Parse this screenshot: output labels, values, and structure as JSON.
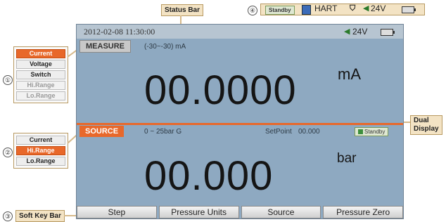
{
  "annotations": {
    "status_bar": "Status Bar",
    "dual_display": "Dual\nDisplay",
    "soft_key_bar": "Soft Key Bar",
    "markers": [
      "①",
      "②",
      "③",
      "④"
    ]
  },
  "status_legend": {
    "standby": "Standby",
    "hart": "HART",
    "voltage": "24V"
  },
  "status_bar": {
    "datetime": "2012-02-08   11:30:00",
    "voltage": "24V"
  },
  "measure": {
    "tab": "MEASURE",
    "range": "(-30~-30) mA",
    "value": "00.0000",
    "unit": "mA"
  },
  "source": {
    "tab": "SOURCE",
    "range": "0 ~ 25bar G",
    "setpoint_label": "SetPoint",
    "setpoint_value": "00.000",
    "standby": "Standby",
    "value": "00.000",
    "unit": "bar"
  },
  "measure_menu": [
    {
      "label": "Current",
      "state": "selected"
    },
    {
      "label": "Voltage",
      "state": "normal"
    },
    {
      "label": "Switch",
      "state": "normal"
    },
    {
      "label": "Hi.Range",
      "state": "disabled"
    },
    {
      "label": "Lo.Range",
      "state": "disabled"
    }
  ],
  "source_menu": [
    {
      "label": "Current",
      "state": "normal"
    },
    {
      "label": "Hi.Range",
      "state": "selected"
    },
    {
      "label": "Lo.Range",
      "state": "normal"
    }
  ],
  "soft_keys": [
    "Step",
    "Pressure Units",
    "Source",
    "Pressure Zero"
  ],
  "colors": {
    "screen": "#8ea9c1",
    "accent": "#e8682a",
    "status_bar": "#b7c5d1"
  }
}
